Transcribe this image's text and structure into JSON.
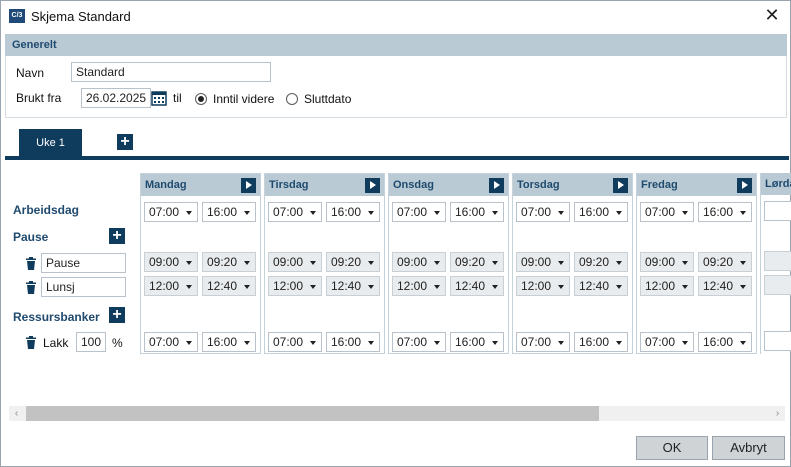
{
  "window": {
    "title": "Skjema Standard",
    "app_icon_text": "C/¥3"
  },
  "general": {
    "section_title": "Generelt",
    "name_label": "Navn",
    "name_value": "Standard",
    "used_from_label": "Brukt fra",
    "date_value": "26.02.2025",
    "til_label": "til",
    "radio_until_further": "Inntil videre",
    "radio_end_date": "Sluttdato",
    "selected": "Inntil videre"
  },
  "tabs": {
    "active_label": "Uke 1"
  },
  "rows": {
    "workday_label": "Arbeidsdag",
    "pause_label": "Pause",
    "pauses": [
      {
        "name": "Pause"
      },
      {
        "name": "Lunsj"
      }
    ],
    "resources_label": "Ressursbanker",
    "resource": {
      "name": "Lakk",
      "percent": "100",
      "unit": "%"
    }
  },
  "days": [
    {
      "name": "Mandag",
      "work_start": "07:00",
      "work_end": "16:00",
      "p1_start": "09:00",
      "p1_end": "09:20",
      "p2_start": "12:00",
      "p2_end": "12:40",
      "r_start": "07:00",
      "r_end": "16:00"
    },
    {
      "name": "Tirsdag",
      "work_start": "07:00",
      "work_end": "16:00",
      "p1_start": "09:00",
      "p1_end": "09:20",
      "p2_start": "12:00",
      "p2_end": "12:40",
      "r_start": "07:00",
      "r_end": "16:00"
    },
    {
      "name": "Onsdag",
      "work_start": "07:00",
      "work_end": "16:00",
      "p1_start": "09:00",
      "p1_end": "09:20",
      "p2_start": "12:00",
      "p2_end": "12:40",
      "r_start": "07:00",
      "r_end": "16:00"
    },
    {
      "name": "Torsdag",
      "work_start": "07:00",
      "work_end": "16:00",
      "p1_start": "09:00",
      "p1_end": "09:20",
      "p2_start": "12:00",
      "p2_end": "12:40",
      "r_start": "07:00",
      "r_end": "16:00"
    },
    {
      "name": "Fredag",
      "work_start": "07:00",
      "work_end": "16:00",
      "p1_start": "09:00",
      "p1_end": "09:20",
      "p2_start": "12:00",
      "p2_end": "12:40",
      "r_start": "07:00",
      "r_end": "16:00"
    }
  ],
  "partial_day": {
    "name": "Lørdag"
  },
  "buttons": {
    "ok": "OK",
    "cancel": "Avbryt"
  }
}
